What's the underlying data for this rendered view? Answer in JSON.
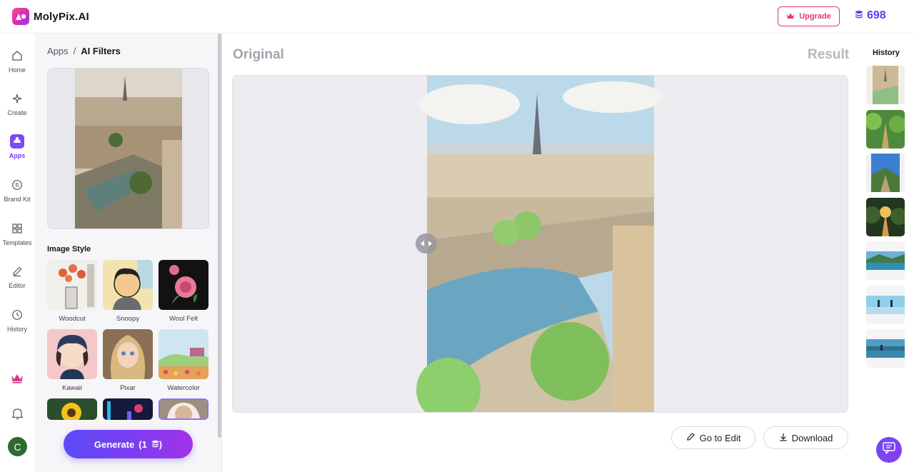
{
  "header": {
    "logo_text": "MolyPix.AI",
    "upgrade_label": "Upgrade",
    "credits": "698"
  },
  "nav": {
    "items": [
      {
        "label": "Home",
        "icon": "home-icon"
      },
      {
        "label": "Create",
        "icon": "sparkles-icon"
      },
      {
        "label": "Apps",
        "icon": "apps-icon",
        "active": true
      },
      {
        "label": "Brand Kit",
        "icon": "brand-kit-icon"
      },
      {
        "label": "Templates",
        "icon": "templates-icon"
      },
      {
        "label": "Editor",
        "icon": "pencil-icon"
      },
      {
        "label": "History",
        "icon": "clock-icon"
      }
    ],
    "avatar_initial": "C"
  },
  "panel": {
    "breadcrumb": {
      "parent": "Apps",
      "separator": "/",
      "current": "AI Filters"
    },
    "section_title": "Image Style",
    "styles": [
      {
        "name": "Woodcut"
      },
      {
        "name": "Snoopy"
      },
      {
        "name": "Wool Felt"
      },
      {
        "name": "Kawaii"
      },
      {
        "name": "Pixar"
      },
      {
        "name": "Watercolor"
      }
    ],
    "generate_label": "Generate",
    "generate_cost": "(1",
    "generate_cost_end": ")"
  },
  "main": {
    "original_label": "Original",
    "result_label": "Result",
    "go_to_edit_label": "Go to Edit",
    "download_label": "Download"
  },
  "history": {
    "title": "History"
  },
  "colors": {
    "accent": "#6b3df5",
    "upgrade": "#e8337a",
    "credits": "#5a3bf0"
  }
}
